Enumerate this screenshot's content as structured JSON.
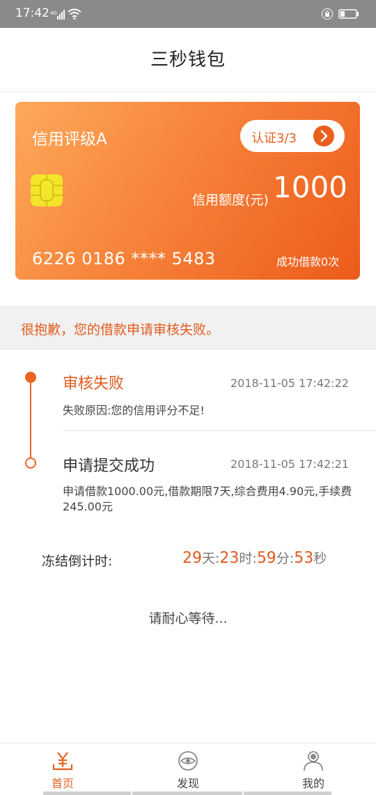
{
  "status_bar": {
    "time": "17:42"
  },
  "header": {
    "title": "三秒钱包"
  },
  "card": {
    "credit_level": "信用评级A",
    "verify_label": "认证3/3",
    "limit_label": "信用额度(元)",
    "limit_value": "1000",
    "card_number": "6226 0186 **** 5483",
    "loan_count": "成功借款0次"
  },
  "notice": {
    "text": "很抱歉，您的借款申请审核失败。"
  },
  "timeline": [
    {
      "title": "审核失败",
      "time": "2018-11-05 17:42:22",
      "desc": "失败原因:您的信用评分不足!"
    },
    {
      "title": "申请提交成功",
      "time": "2018-11-05 17:42:21",
      "desc": "申请借款1000.00元,借款期限7天,综合费用4.90元,手续费245.00元"
    }
  ],
  "countdown": {
    "label": "冻结倒计时:",
    "days": "29",
    "days_unit": "天:",
    "hours": "23",
    "hours_unit": "时:",
    "minutes": "59",
    "minutes_unit": "分:",
    "seconds": "53",
    "seconds_unit": "秒"
  },
  "waiting_text": "请耐心等待...",
  "tabs": [
    {
      "label": "首页",
      "icon": "yen-icon",
      "active": true
    },
    {
      "label": "发现",
      "icon": "discover-icon",
      "active": false
    },
    {
      "label": "我的",
      "icon": "user-icon",
      "active": false
    }
  ],
  "colors": {
    "accent": "#e8601f",
    "card_start": "#fda95a",
    "card_end": "#ec5b1a",
    "chip": "#f4e52a"
  }
}
